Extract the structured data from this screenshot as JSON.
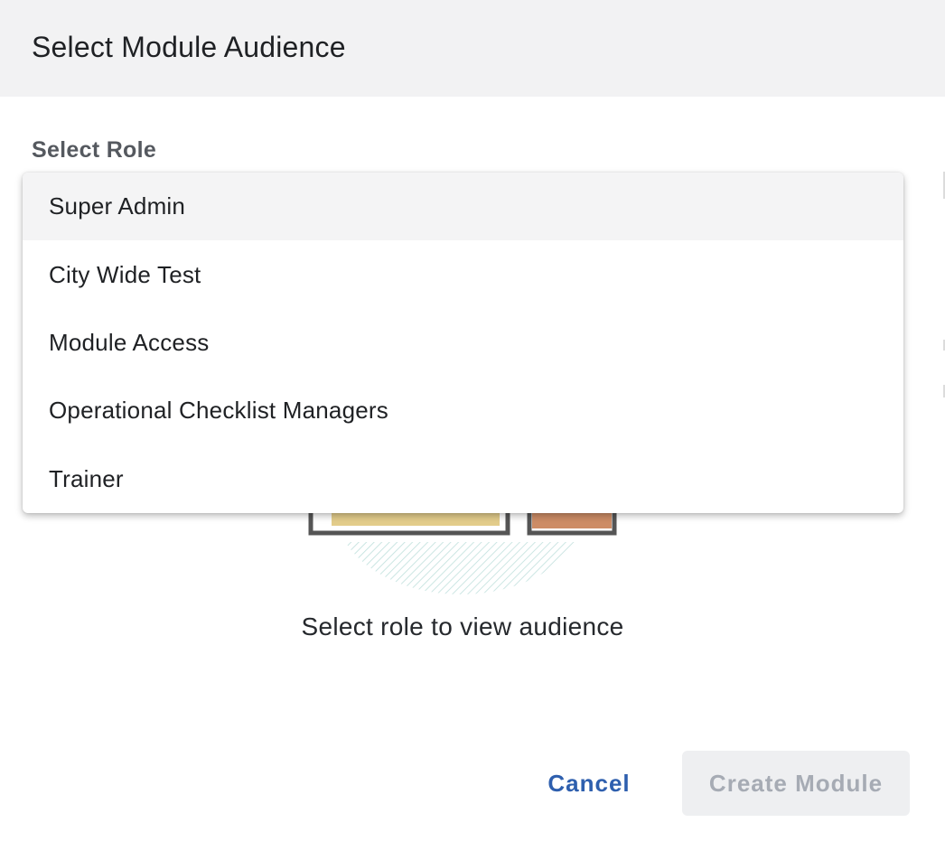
{
  "dialog": {
    "title": "Select Module Audience"
  },
  "role_select": {
    "label": "Select Role",
    "options": [
      "Super Admin",
      "City Wide Test",
      "Module Access",
      "Operational Checklist Managers",
      "Trainer"
    ],
    "highlighted_option": "Super Admin"
  },
  "empty_state": {
    "message": "Select role to view audience",
    "icon": "empty-audience-illustration"
  },
  "footer": {
    "cancel_label": "Cancel",
    "create_label": "Create Module"
  },
  "colors": {
    "header_bg": "#f2f2f3",
    "link_blue": "#2e5fae",
    "disabled_button_bg": "#eeeff1",
    "disabled_button_text": "#a6abb4",
    "illustration_yellow": "#e3cc8b",
    "illustration_orange": "#cd8c66"
  }
}
